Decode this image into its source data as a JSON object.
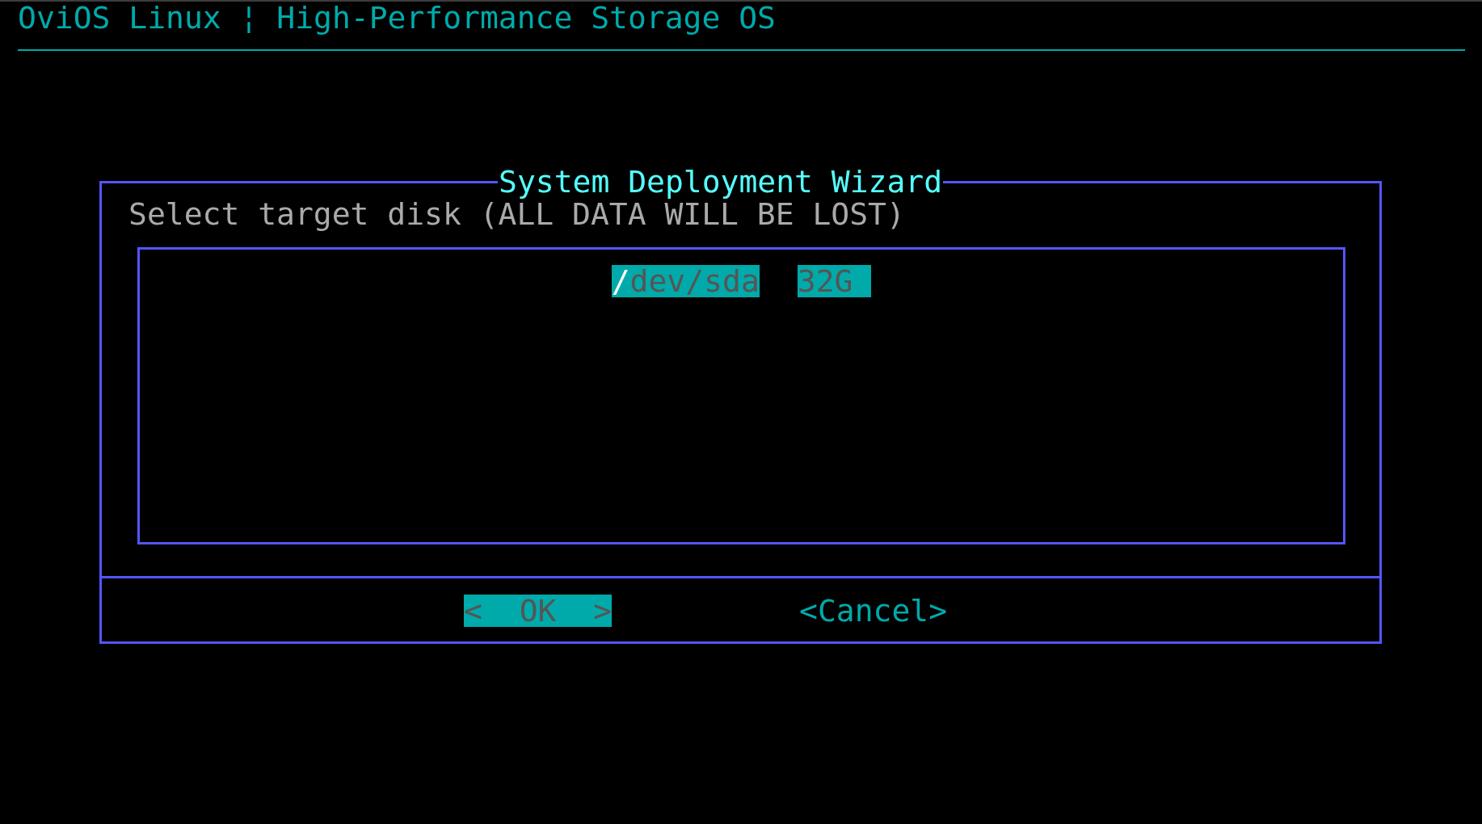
{
  "header": {
    "title": "OviOS Linux ¦ High-Performance Storage OS"
  },
  "dialog": {
    "title": "System Deployment Wizard",
    "prompt": "Select target disk (ALL DATA WILL BE LOST)",
    "items": [
      {
        "device": "/dev/sda",
        "size": "32G",
        "selected": true
      }
    ],
    "buttons": [
      {
        "label": "<  OK  >",
        "selected": true
      },
      {
        "label": "<Cancel>",
        "selected": false
      }
    ]
  }
}
